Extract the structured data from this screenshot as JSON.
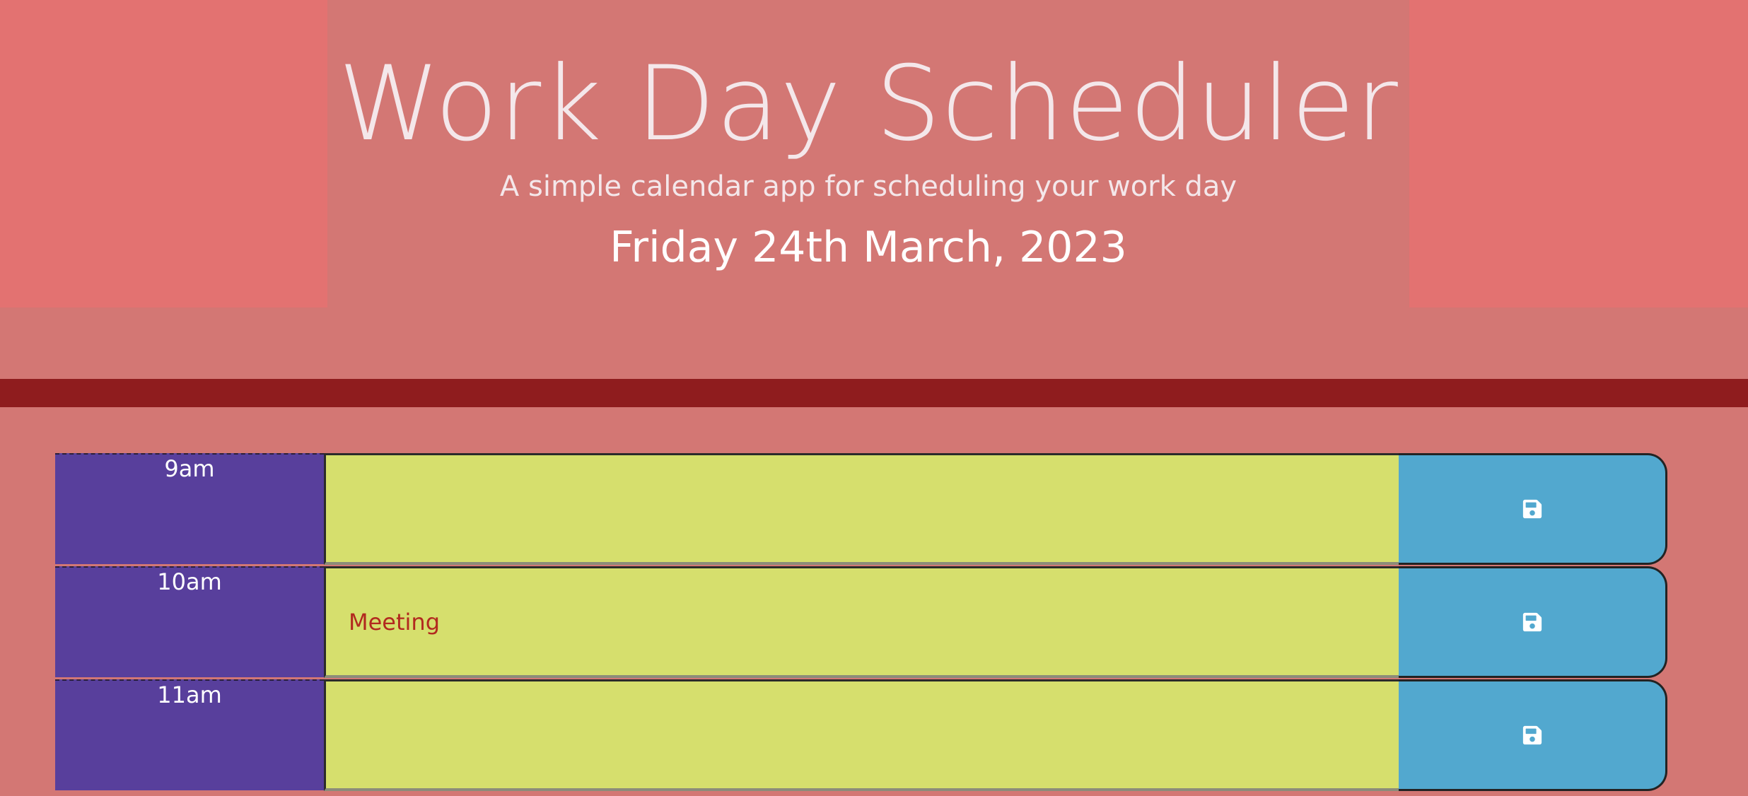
{
  "header": {
    "title": "Work Day Scheduler",
    "subtitle": "A simple calendar app for scheduling your work day",
    "current_date": "Friday 24th March, 2023"
  },
  "colors": {
    "background": "#d37774",
    "side_panels": "#e37271",
    "divider": "#8f1c1e",
    "hour_column": "#583f9c",
    "description_present": "#d6df6d",
    "save_button": "#52a8cf",
    "description_text": "#b2291f"
  },
  "time_blocks": [
    {
      "hour": "9am",
      "description": "",
      "save_icon": "floppy-disk-icon"
    },
    {
      "hour": "10am",
      "description": "Meeting",
      "save_icon": "floppy-disk-icon"
    },
    {
      "hour": "11am",
      "description": "",
      "save_icon": "floppy-disk-icon"
    }
  ]
}
